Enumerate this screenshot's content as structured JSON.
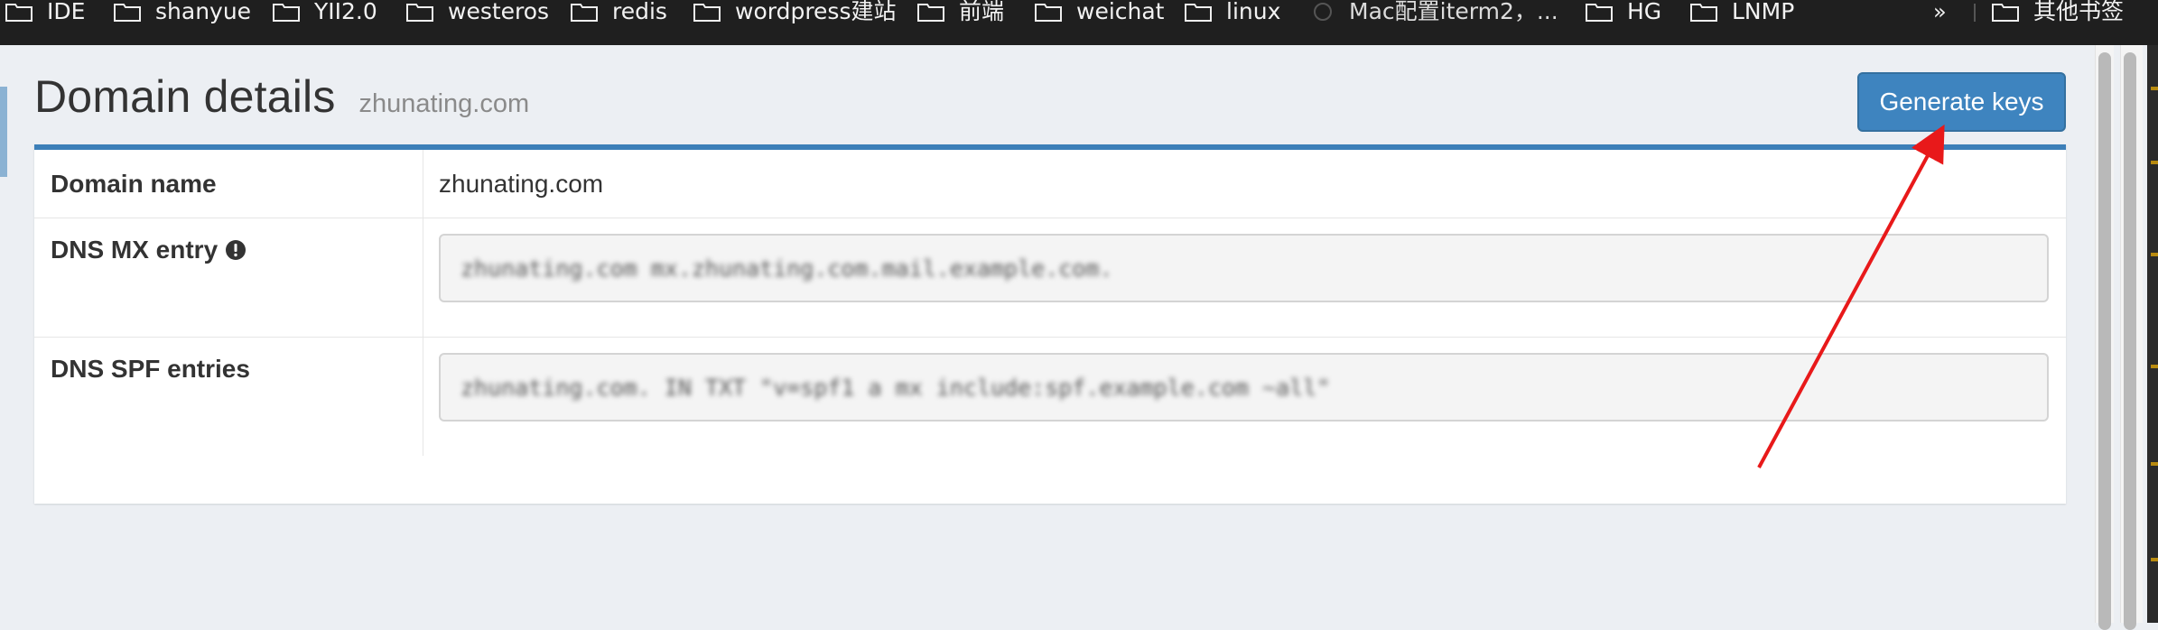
{
  "bookmarks": {
    "items": [
      {
        "label": "IDE"
      },
      {
        "label": "shanyue"
      },
      {
        "label": "YII2.0"
      },
      {
        "label": "westeros"
      },
      {
        "label": "redis"
      },
      {
        "label": "wordpress建站"
      },
      {
        "label": "前端"
      },
      {
        "label": "weichat"
      },
      {
        "label": "linux"
      },
      {
        "label": "Mac配置iterm2，..."
      },
      {
        "label": "HG"
      },
      {
        "label": "LNMP"
      }
    ],
    "overflow": "»",
    "other": "其他书签"
  },
  "page": {
    "title": "Domain details",
    "subtitle": "zhunating.com",
    "generate_button": "Generate keys"
  },
  "details": {
    "domain_name": {
      "label": "Domain name",
      "value": "zhunating.com"
    },
    "dns_mx": {
      "label": "DNS MX entry",
      "value": "zhunating.com mx.zhunating.com.mail.example.com."
    },
    "dns_spf": {
      "label": "DNS SPF entries",
      "value": "zhunating.com. IN TXT \"v=spf1 a mx include:spf.example.com ~all\""
    }
  },
  "colors": {
    "accent": "#3c7fb8",
    "annotation_arrow": "#e8191a"
  }
}
